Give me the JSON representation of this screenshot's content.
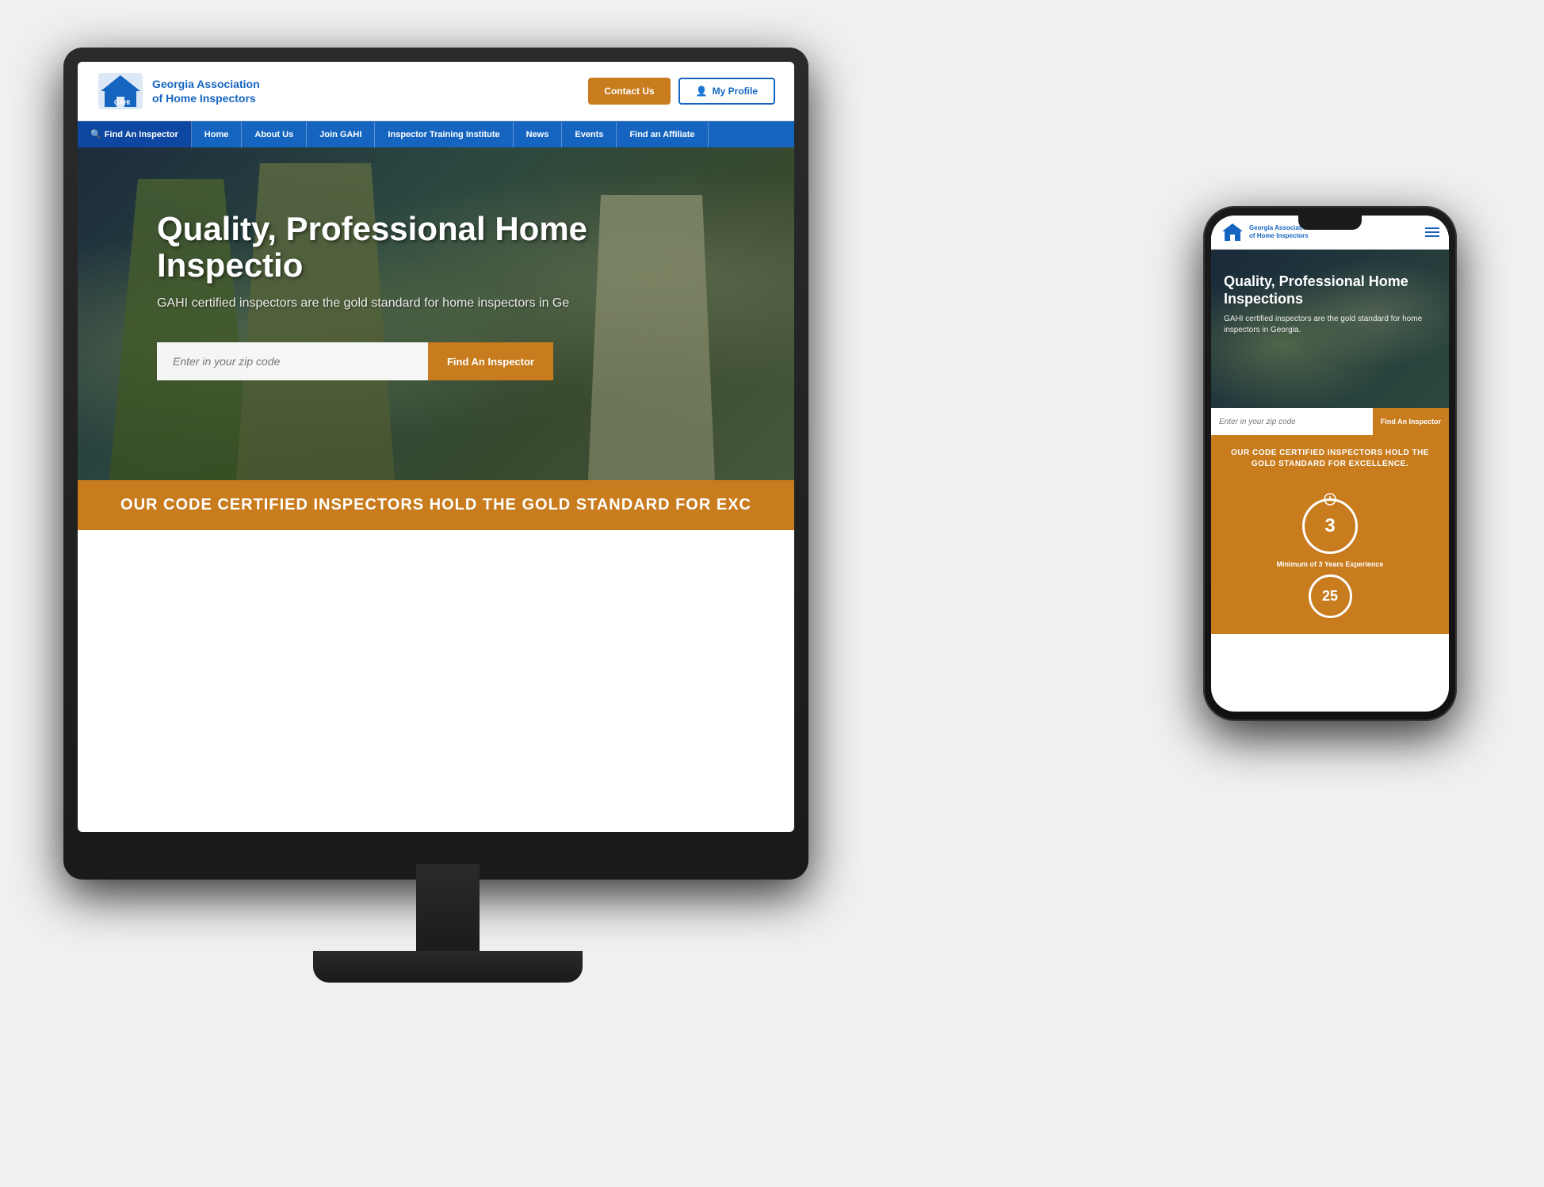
{
  "scene": {
    "bg_color": "#1a1a1a"
  },
  "desktop": {
    "header": {
      "logo_org": "Georgia Association",
      "logo_org2": "of Home Inspectors",
      "contact_label": "Contact Us",
      "profile_label": "My Profile"
    },
    "nav": {
      "items": [
        {
          "label": "Find An Inspector",
          "icon": "search"
        },
        {
          "label": "Home"
        },
        {
          "label": "About Us"
        },
        {
          "label": "Join GAHI"
        },
        {
          "label": "Inspector Training Institute"
        },
        {
          "label": "News"
        },
        {
          "label": "Events"
        },
        {
          "label": "Find an Affiliate"
        }
      ]
    },
    "hero": {
      "title": "Quality, Professional Home Inspectio",
      "subtitle": "GAHI certified inspectors are the gold standard for home inspectors in Ge",
      "search_placeholder": "Enter in your zip code",
      "search_button": "Find An Inspector"
    },
    "banner": {
      "text": "OUR CODE CERTIFIED INSPECTORS HOLD THE GOLD STANDARD FOR EXC"
    }
  },
  "mobile": {
    "header": {
      "logo_org": "Georgia Association",
      "logo_org2": "of Home Inspectors"
    },
    "hero": {
      "title": "Quality, Professional Home Inspections",
      "subtitle": "GAHI certified inspectors are the gold standard for home inspectors in Georgia.",
      "search_placeholder": "Enter in your zip code",
      "search_button": "Find An Inspector"
    },
    "banner": {
      "text": "OUR CODE CERTIFIED INSPECTORS HOLD THE GOLD STANDARD FOR EXCELLENCE."
    },
    "badges": {
      "years_number": "3",
      "years_label": "Minimum of 3 Years Experience",
      "hours_number": "25"
    }
  }
}
